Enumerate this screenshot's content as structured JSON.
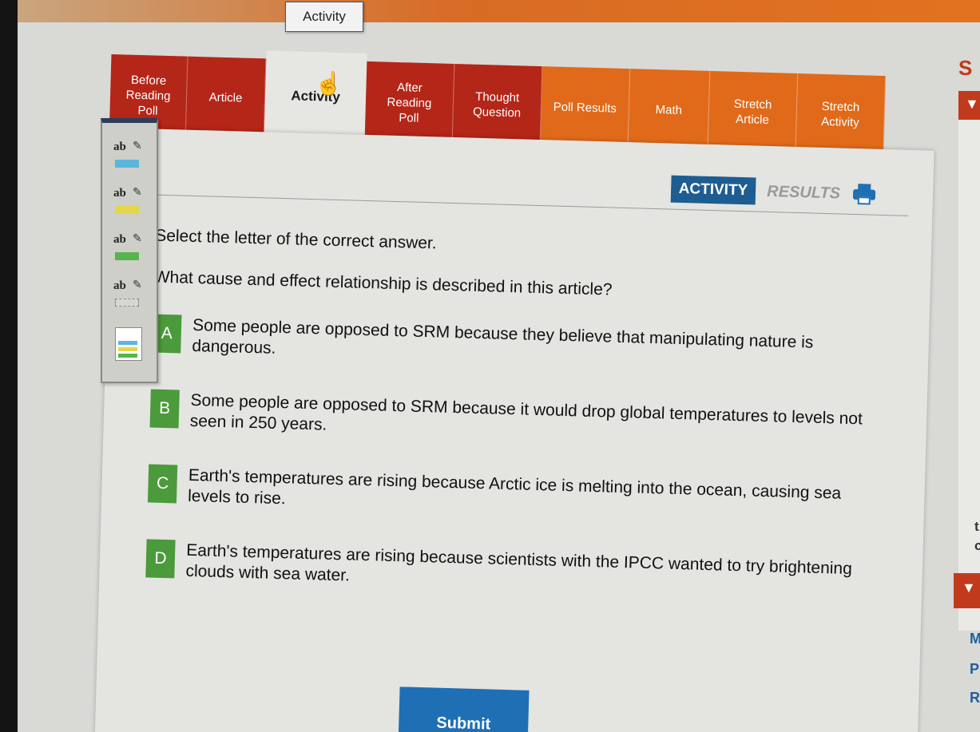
{
  "tooltip": "Activity",
  "tabs": [
    {
      "label": "Before\nReading\nPoll",
      "color": "red"
    },
    {
      "label": "Article",
      "color": "red"
    },
    {
      "label": "Activity",
      "color": "active"
    },
    {
      "label": "After\nReading\nPoll",
      "color": "red"
    },
    {
      "label": "Thought\nQuestion",
      "color": "red"
    },
    {
      "label": "Poll Results",
      "color": "orange"
    },
    {
      "label": "Math",
      "color": "orange"
    },
    {
      "label": "Stretch\nArticle",
      "color": "orange"
    },
    {
      "label": "Stretch\nActivity",
      "color": "orange"
    }
  ],
  "mode": {
    "activity": "ACTIVITY",
    "results": "RESULTS"
  },
  "content": {
    "instruction": "Select the letter of the correct answer.",
    "question": "What cause and effect relationship is described in this article?",
    "options": [
      {
        "letter": "A",
        "text": "Some people are opposed to SRM because they believe that manipulating nature is dangerous."
      },
      {
        "letter": "B",
        "text": "Some people are opposed to SRM because it would drop global temperatures to levels not seen in 250 years."
      },
      {
        "letter": "C",
        "text": "Earth's temperatures are rising because Arctic ice is melting into the ocean, causing sea levels to rise."
      },
      {
        "letter": "D",
        "text": "Earth's temperatures are rising because scientists with the IPCC wanted to try brightening clouds with sea water."
      }
    ],
    "submit": "Submit"
  },
  "toolbar": {
    "tools": [
      {
        "label": "ab",
        "swatch": "#5bb6d9"
      },
      {
        "label": "ab",
        "swatch": "#e4d64a"
      },
      {
        "label": "ab",
        "swatch": "#58b54b"
      },
      {
        "label": "ab",
        "swatch": "#d7d7d2"
      }
    ]
  },
  "sidebar": {
    "title": "S",
    "fragments": [
      "t",
      "c"
    ],
    "links": [
      "M",
      "P",
      "R"
    ]
  },
  "colors": {
    "tab_red": "#b42617",
    "tab_orange": "#e06a1a",
    "accent_blue": "#1f6fb4",
    "answer_green": "#4b9a3b"
  }
}
